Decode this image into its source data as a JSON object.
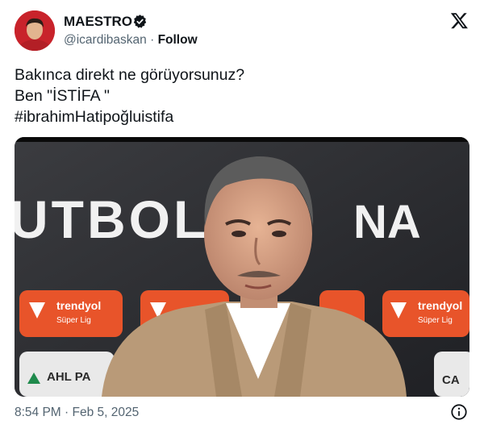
{
  "header": {
    "display_name": "MAESTRO",
    "handle": "@icardibaskan",
    "separator": "·",
    "follow_label": "Follow",
    "verified_icon": "verified-badge-icon",
    "platform_icon": "x-logo-icon"
  },
  "tweet": {
    "lines": [
      "Bakınca direkt ne görüyorsunuz?",
      "Ben \"İSTİFA \"",
      "#ibrahimHatipoğluistifa"
    ]
  },
  "media": {
    "backdrop_text_left": "UTBOL",
    "backdrop_text_right": "NA",
    "sponsor": "trendyol",
    "sponsor_sub": "Süper Lig",
    "sponsor_2": "AHL PA",
    "sponsor_3": "CA"
  },
  "footer": {
    "time": "8:54 PM",
    "separator": "·",
    "date": "Feb 5, 2025",
    "info_icon": "info-icon"
  },
  "colors": {
    "brand_red": "#e8542a",
    "text": "#0f1419",
    "muted": "#536471",
    "verified": "#0f1419"
  }
}
